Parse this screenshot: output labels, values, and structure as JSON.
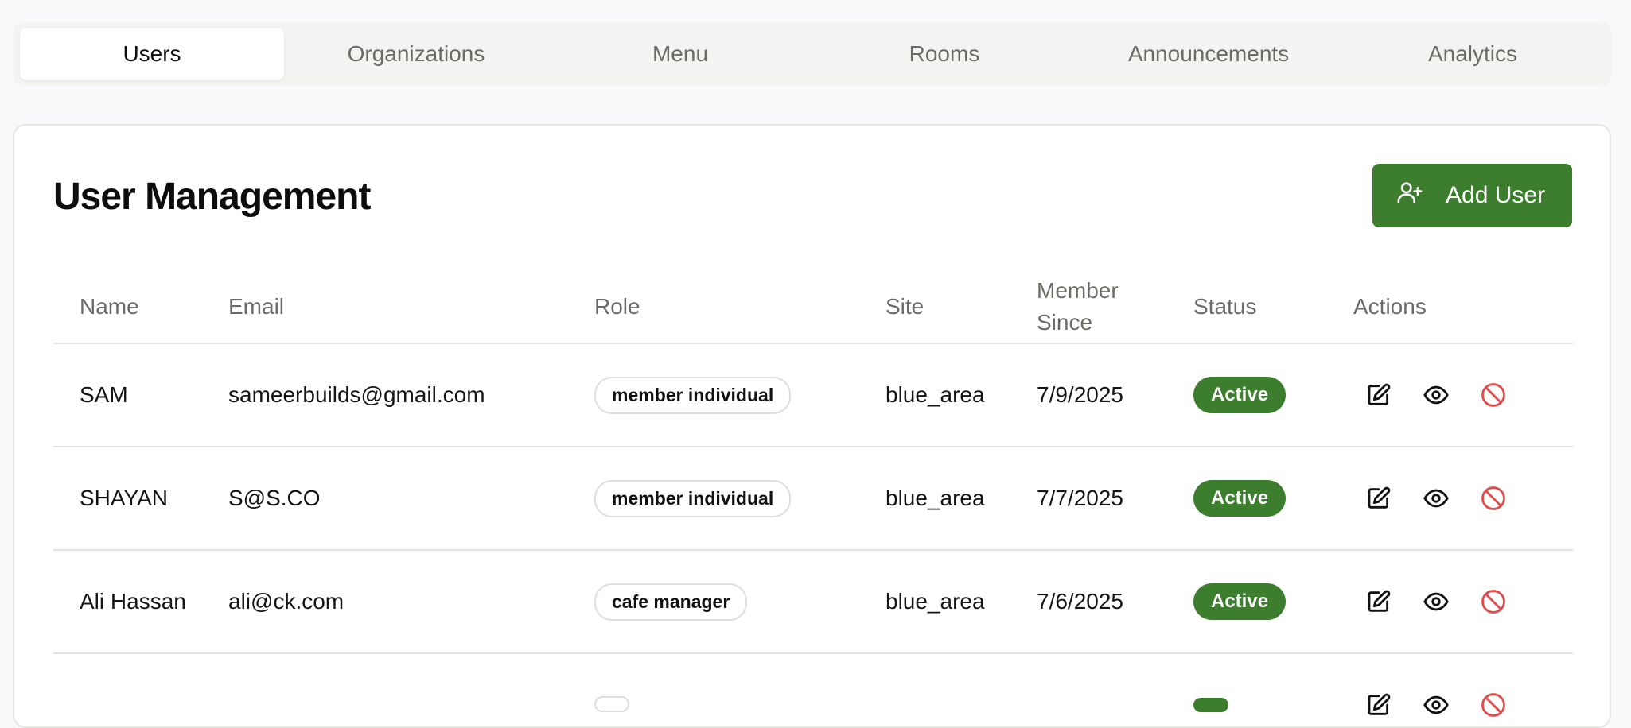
{
  "tabs": [
    {
      "label": "Users",
      "active": true
    },
    {
      "label": "Organizations",
      "active": false
    },
    {
      "label": "Menu",
      "active": false
    },
    {
      "label": "Rooms",
      "active": false
    },
    {
      "label": "Announcements",
      "active": false
    },
    {
      "label": "Analytics",
      "active": false
    }
  ],
  "panel": {
    "title": "User Management",
    "add_button_label": "Add User",
    "add_button_icon": "user-plus-icon"
  },
  "table": {
    "headers": {
      "name": "Name",
      "email": "Email",
      "role": "Role",
      "site": "Site",
      "member_since_1": "Member",
      "member_since_2": "Since",
      "status": "Status",
      "actions": "Actions"
    },
    "rows": [
      {
        "name": "SAM",
        "email": "sameerbuilds@gmail.com",
        "role": "member individual",
        "site": "blue_area",
        "member_since": "7/9/2025",
        "status": "Active"
      },
      {
        "name": "SHAYAN",
        "email": "S@S.CO",
        "role": "member individual",
        "site": "blue_area",
        "member_since": "7/7/2025",
        "status": "Active"
      },
      {
        "name": "Ali Hassan",
        "email": "ali@ck.com",
        "role": "cafe manager",
        "site": "blue_area",
        "member_since": "7/6/2025",
        "status": "Active"
      },
      {
        "name": "",
        "email": "",
        "role": "",
        "site": "",
        "member_since": "",
        "status": ""
      }
    ],
    "action_icons": [
      "edit-icon",
      "eye-icon",
      "ban-icon"
    ]
  },
  "colors": {
    "accent_green": "#3c7d2e",
    "ban_red": "#e04b4b",
    "muted_text": "#6e6b66",
    "tab_bar_bg": "#f3f3f1"
  }
}
